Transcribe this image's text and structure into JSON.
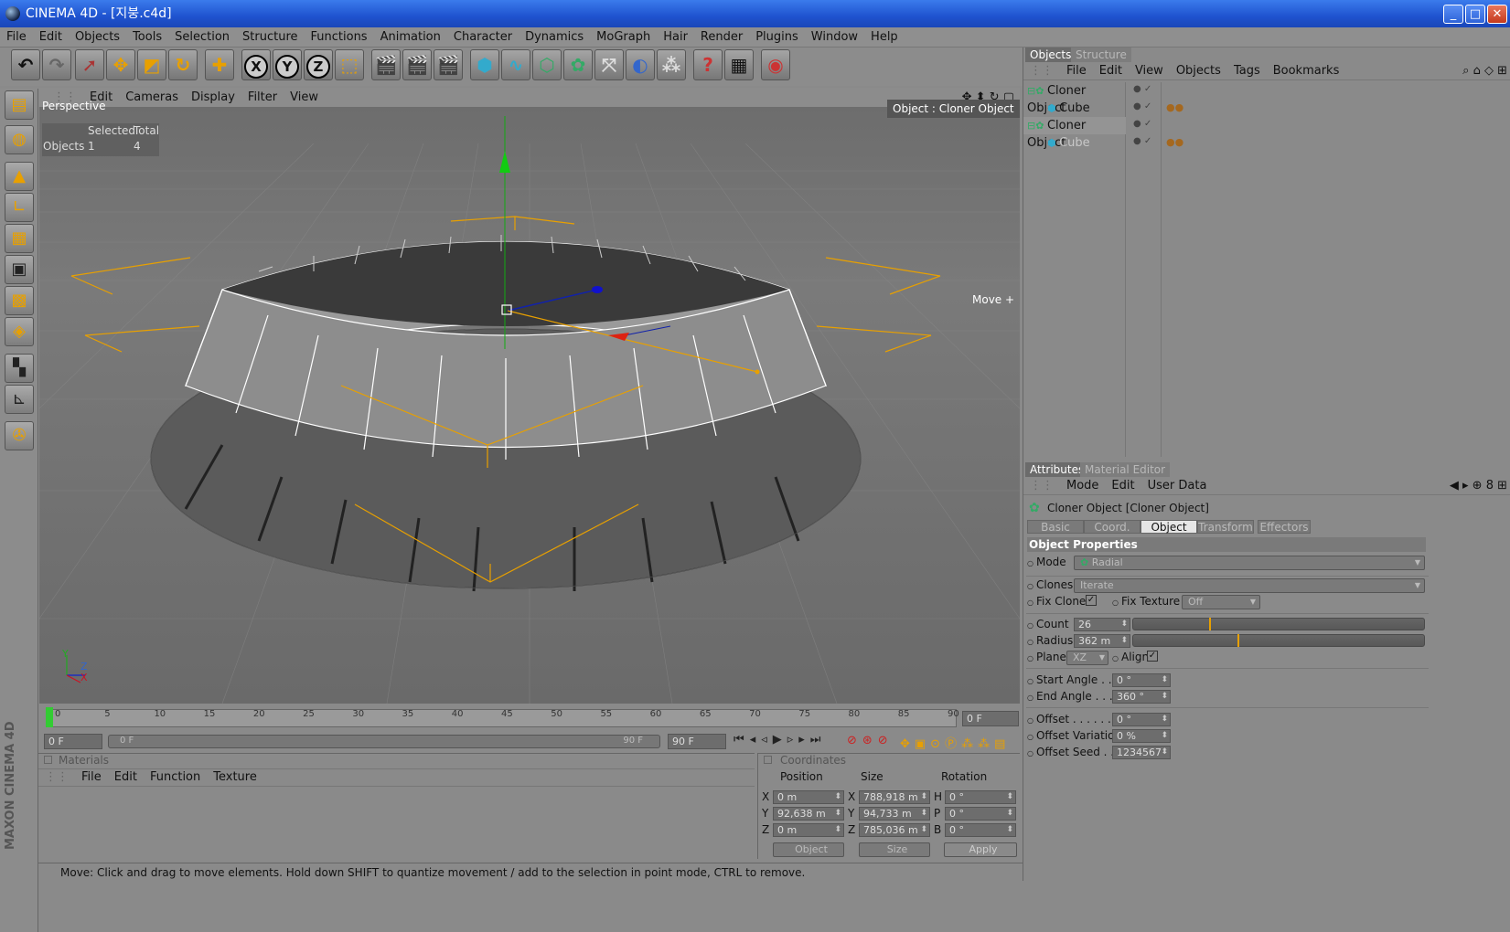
{
  "window": {
    "title": "CINEMA 4D - [지붕.c4d]",
    "min": "_",
    "max": "□",
    "close": "✕"
  },
  "menu": [
    "File",
    "Edit",
    "Objects",
    "Tools",
    "Selection",
    "Structure",
    "Functions",
    "Animation",
    "Character",
    "Dynamics",
    "MoGraph",
    "Hair",
    "Render",
    "Plugins",
    "Window",
    "Help"
  ],
  "viewport": {
    "menu": [
      "Edit",
      "Cameras",
      "Display",
      "Filter",
      "View"
    ],
    "label": "Perspective",
    "selection": {
      "col1": "Selected",
      "col2": "Total",
      "row": "Objects",
      "selected": "1",
      "total": "4"
    },
    "object_label": "Object : Cloner Object",
    "move_label": "Move +",
    "axes": {
      "y": "Y",
      "z": "Z",
      "x": "X"
    }
  },
  "timeline": {
    "ticks": [
      "0",
      "5",
      "10",
      "15",
      "20",
      "25",
      "30",
      "35",
      "40",
      "45",
      "50",
      "55",
      "60",
      "65",
      "70",
      "75",
      "80",
      "85",
      "90"
    ],
    "current": "0 F"
  },
  "transport": {
    "start": "0 F",
    "range_start": "0 F",
    "range_end": "90 F",
    "end": "90 F"
  },
  "materials": {
    "title": "Materials",
    "menu": [
      "File",
      "Edit",
      "Function",
      "Texture"
    ]
  },
  "coords": {
    "title": "Coordinates",
    "headers": [
      "Position",
      "Size",
      "Rotation"
    ],
    "rows": [
      {
        "axis": "X",
        "pos": "0 m",
        "saxis": "X",
        "size": "788,918 m",
        "raxis": "H",
        "rot": "0 °"
      },
      {
        "axis": "Y",
        "pos": "92,638 m",
        "saxis": "Y",
        "size": "94,733 m",
        "raxis": "P",
        "rot": "0 °"
      },
      {
        "axis": "Z",
        "pos": "0 m",
        "saxis": "Z",
        "size": "785,036 m",
        "raxis": "B",
        "rot": "0 °"
      }
    ],
    "mode1": "Object",
    "mode2": "Size",
    "apply": "Apply"
  },
  "status": "Move: Click and drag to move elements. Hold down SHIFT to quantize movement / add to the selection in point mode, CTRL to remove.",
  "objects_panel": {
    "tabs": [
      "Objects",
      "Structure"
    ],
    "menu": [
      "File",
      "Edit",
      "View",
      "Objects",
      "Tags",
      "Bookmarks"
    ],
    "tree": [
      {
        "name": "Cloner Object",
        "level": 0
      },
      {
        "name": "Cube",
        "level": 1
      },
      {
        "name": "Cloner Object",
        "level": 0
      },
      {
        "name": "Cube",
        "level": 1
      }
    ]
  },
  "attributes": {
    "tabs": [
      "Attributes",
      "Material Editor"
    ],
    "menu": [
      "Mode",
      "Edit",
      "User Data"
    ],
    "header": "Cloner Object [Cloner Object]",
    "subtabs": [
      "Basic",
      "Coord.",
      "Object",
      "Transform",
      "Effectors"
    ],
    "section": "Object Properties",
    "mode_label": "Mode",
    "mode_value": "Radial",
    "clones_label": "Clones",
    "clones_value": "Iterate",
    "fixclone_label": "Fix Clone",
    "fixtexture_label": "Fix Texture",
    "fixtexture_value": "Off",
    "count_label": "Count",
    "count_value": "26",
    "count_level": 0.26,
    "radius_label": "Radius",
    "radius_value": "362 m",
    "radius_level": 0.36,
    "plane_label": "Plane",
    "plane_value": "XZ",
    "align_label": "Align",
    "startangle_label": "Start Angle . . .",
    "startangle_value": "0 °",
    "endangle_label": "End Angle . . . .",
    "endangle_value": "360 °",
    "offset_label": "Offset . . . . . . . .",
    "offset_value": "0 °",
    "offsetvar_label": "Offset Variation",
    "offsetvar_value": "0 %",
    "offsetseed_label": "Offset Seed . . .",
    "offsetseed_value": "1234567"
  },
  "branding": "MAXON CINEMA 4D",
  "colors": {
    "accent": "#e8a000",
    "viewport": "#787878",
    "panel": "#8a8a8a"
  }
}
